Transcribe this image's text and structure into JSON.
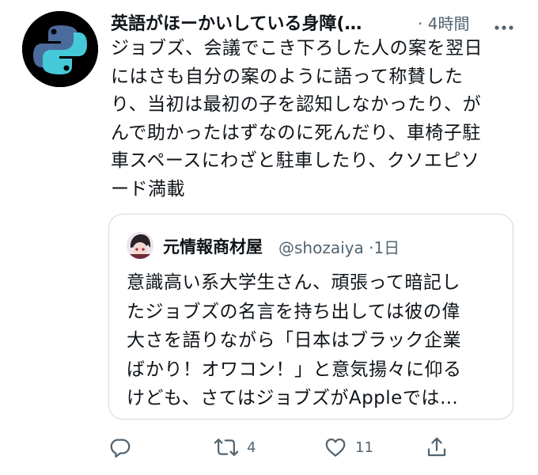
{
  "tweet": {
    "display_name": "英語がほーかいしている身障(",
    "separator": "·",
    "time": "4時間",
    "lines": [
      "ジョブズ、会議でこき下ろした人の案を翌日",
      "にはさも自分の案のように語って称賛した",
      "り、当初は最初の子を認知しなかったり、が",
      "んで助かったはずなのに死んだり、車椅子駐",
      "車スペースにわざと駐車したり、クソエピソ",
      "ード満載"
    ]
  },
  "quote": {
    "name": "元情報商材屋",
    "handle": "@shozaiya",
    "separator": "·",
    "time": "1日",
    "lines": [
      "意識高い系大学生さん、頑張って暗記し",
      "たジョブズの名言を持ち出しては彼の偉",
      "大さを語りながら「日本はブラック企業",
      "ばかり！オワコン！」と意気揚々に仰る",
      "けども、さてはジョブズがAppleでは…"
    ]
  },
  "actions": {
    "reply_count": "",
    "retweet_count": "4",
    "like_count": "11"
  },
  "colors": {
    "text": "#0f1419",
    "secondary": "#536471",
    "border": "#cfd9de",
    "avatar_blue": "#4b6b9c",
    "avatar_teal": "#45c8d8"
  },
  "icons": [
    "python-logo-avatar",
    "more-icon",
    "reply-icon",
    "retweet-icon",
    "like-icon",
    "share-icon"
  ]
}
